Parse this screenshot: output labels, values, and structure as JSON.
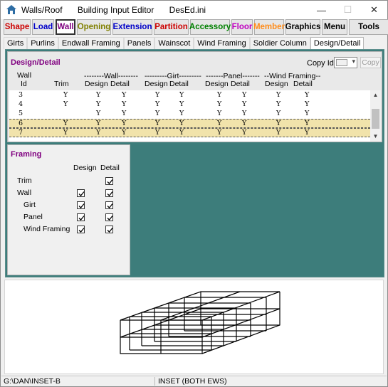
{
  "window": {
    "title_parts": [
      "Walls/Roof",
      "Building Input Editor",
      "DesEd.ini"
    ],
    "controls": [
      "—",
      "☐",
      "✕"
    ]
  },
  "toolbar": {
    "buttons": [
      {
        "label": "Shape",
        "color": "#cc0000"
      },
      {
        "label": "Load",
        "color": "#0000c8"
      },
      {
        "label": "Wall",
        "color": "#800080",
        "active": true
      },
      {
        "label": "Opening",
        "color": "#808000"
      },
      {
        "label": "Extension",
        "color": "#0000c8"
      },
      {
        "label": "Partition",
        "color": "#cc0000"
      },
      {
        "label": "Accessory",
        "color": "#008000"
      },
      {
        "label": "Floor",
        "color": "#c000c0"
      },
      {
        "label": "Member",
        "color": "#ff8c1a"
      },
      {
        "label": "Graphics",
        "color": "#000000"
      },
      {
        "label": "Menu",
        "color": "#000000"
      },
      {
        "label": "Tools",
        "color": "#000000"
      }
    ]
  },
  "tabs": [
    "Girts",
    "Purlins",
    "Endwall Framing",
    "Panels",
    "Wainscot",
    "Wind Framing",
    "Soldier Column",
    "Design/Detail"
  ],
  "active_tab": "Design/Detail",
  "design_detail": {
    "title": "Design/Detail",
    "copy_label": "Copy Id",
    "copy_button": "Copy",
    "header": {
      "wall": "Wall",
      "id": "Id",
      "trim": "Trim",
      "wall_group": "--------Wall--------",
      "girt_group": "---------Girt---------",
      "panel_group": "-------Panel-------",
      "wind_group": "--Wind Framing--",
      "design": "Design",
      "detail": "Detail"
    },
    "rows": [
      {
        "id": "3",
        "vals": [
          "Y",
          "Y",
          "Y",
          "Y",
          "Y",
          "Y",
          "Y",
          "Y",
          "Y"
        ],
        "selected": false
      },
      {
        "id": "4",
        "vals": [
          "Y",
          "Y",
          "Y",
          "Y",
          "Y",
          "Y",
          "Y",
          "Y",
          "Y"
        ],
        "selected": false
      },
      {
        "id": "5",
        "vals": [
          "",
          "Y",
          "Y",
          "Y",
          "Y",
          "Y",
          "Y",
          "Y",
          "Y"
        ],
        "selected": false
      },
      {
        "id": "6",
        "vals": [
          "Y",
          "Y",
          "Y",
          "Y",
          "Y",
          "Y",
          "Y",
          "Y",
          "Y"
        ],
        "selected": true
      },
      {
        "id": "7",
        "vals": [
          "Y",
          "Y",
          "Y",
          "Y",
          "Y",
          "Y",
          "Y",
          "Y",
          "Y"
        ],
        "selected": true
      }
    ]
  },
  "framing": {
    "title": "Framing",
    "design_header": "Design",
    "detail_header": "Detail",
    "items": [
      {
        "label": "Trim",
        "design": null,
        "detail": true
      },
      {
        "label": "Wall",
        "design": true,
        "detail": true
      },
      {
        "label": "Girt",
        "design": true,
        "detail": true
      },
      {
        "label": "Panel",
        "design": true,
        "detail": true
      },
      {
        "label": "Wind Framing",
        "design": true,
        "detail": true
      }
    ]
  },
  "status": {
    "path": "G:\\DAN\\INSET-B",
    "model": "INSET (BOTH EWS)"
  }
}
